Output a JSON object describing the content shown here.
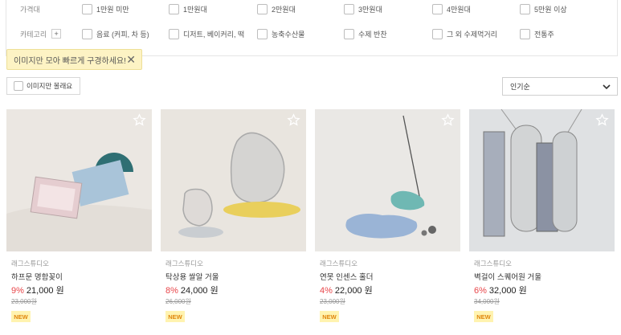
{
  "filters": {
    "price_label": "가격대",
    "price_options": [
      "1만원 미만",
      "1만원대",
      "2만원대",
      "3만원대",
      "4만원대",
      "5만원 이상"
    ],
    "category_label": "카테고리",
    "category_plus": "+",
    "category_options": [
      "음료 (커피, 차 등)",
      "디저트, 베이커리, 떡",
      "농축수산물",
      "수제 반찬",
      "그 외 수제먹거리",
      "전통주"
    ]
  },
  "tooltip": {
    "text": "이미지만 모아 빠르게 구경하세요!",
    "close": "✕"
  },
  "image_only": {
    "label": "이미지만 볼래요"
  },
  "sort": {
    "selected": "인기순"
  },
  "colors": {
    "discount": "#e8464a",
    "badge_bg": "#fff3b0",
    "badge_text": "#e0860c"
  },
  "products": [
    {
      "shop": "래그스튜디오",
      "name": "하프문 명함꽂이",
      "discount": "9%",
      "price": "21,000 원",
      "original_price": "23,000원",
      "badge": "NEW"
    },
    {
      "shop": "래그스튜디오",
      "name": "탁상용 쌀알 거울",
      "discount": "8%",
      "price": "24,000 원",
      "original_price": "26,000원",
      "badge": "NEW"
    },
    {
      "shop": "래그스튜디오",
      "name": "연못 인센스 홀더",
      "discount": "4%",
      "price": "22,000 원",
      "original_price": "23,000원",
      "badge": "NEW"
    },
    {
      "shop": "래그스튜디오",
      "name": "벽걸이 스퀘어원 거울",
      "discount": "6%",
      "price": "32,000 원",
      "original_price": "34,000원",
      "badge": "NEW"
    }
  ]
}
